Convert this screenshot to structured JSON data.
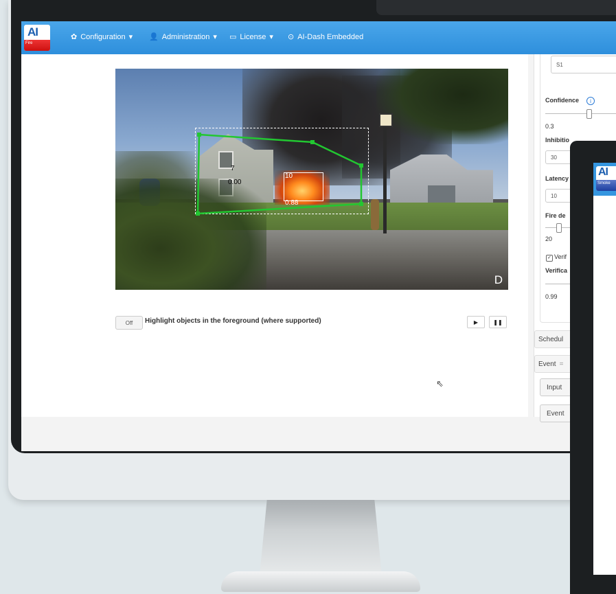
{
  "navbar": {
    "logo_text": "AI",
    "logo_sub": "Fire",
    "items": [
      {
        "label": "Configuration",
        "icon": "gear-icon",
        "glyph": "✿",
        "caret": "▾"
      },
      {
        "label": "Administration",
        "icon": "user-icon",
        "glyph": "👤",
        "caret": "▾"
      },
      {
        "label": "License",
        "icon": "license-icon",
        "glyph": "▭",
        "caret": "▾"
      },
      {
        "label": "AI-Dash Embedded",
        "icon": "dashboard-icon",
        "glyph": "⊙",
        "caret": ""
      }
    ]
  },
  "video": {
    "overlay_num1": "7",
    "overlay_num2": "0.00",
    "box_num1": "10",
    "box_num2": "0.88",
    "badge": "D",
    "zone_color": "#22c731"
  },
  "controls": {
    "toggle_label": "Off",
    "highlight_label": "Highlight objects in the foreground (where supported)",
    "play_glyph": "▶",
    "pause_glyph": "❚❚"
  },
  "panel": {
    "input_s1": "S1",
    "confidence_label": "Confidence",
    "info_glyph": "i",
    "confidence_value": "0.3",
    "inhibition_label": "Inhibitio",
    "inhibition_value": "30",
    "latency_label": "Latency",
    "latency_value": "10",
    "fire_label": "Fire de",
    "fire_value": "20",
    "verify_check": "Verif",
    "verification_label": "Verifica",
    "verification_value": "0.99",
    "schedule_label": "Schedul",
    "event_label": "Event",
    "event_caret": "=",
    "input_btn": "Input",
    "events_btn": "Event"
  },
  "monitor2": {
    "logo_text": "AI",
    "logo_sub": "Smoke"
  }
}
